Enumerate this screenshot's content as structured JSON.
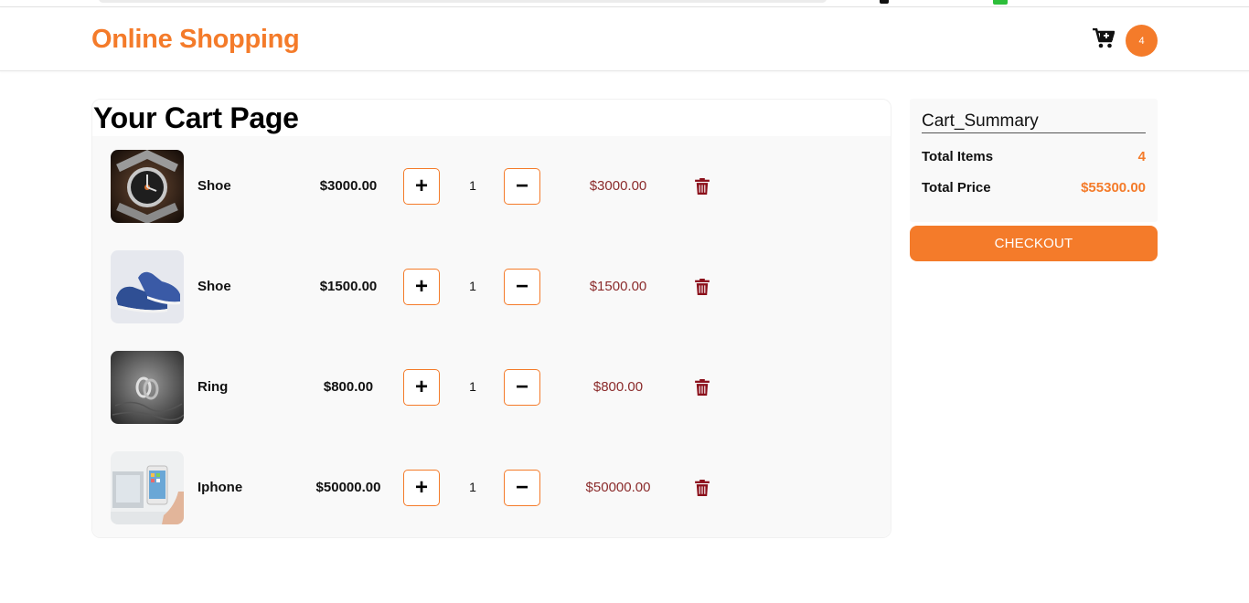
{
  "colors": {
    "accent": "#f47b2a",
    "subtotal": "#8b2b2b",
    "delete": "#8b0f1a"
  },
  "header": {
    "brand": "Online Shopping",
    "cart_icon": "shopping-cart-icon",
    "cart_count": "4"
  },
  "cart": {
    "title": "Your Cart Page",
    "items": [
      {
        "name": "Shoe",
        "price": "$3000.00",
        "quantity": "1",
        "subtotal": "$3000.00",
        "image": "watch"
      },
      {
        "name": "Shoe",
        "price": "$1500.00",
        "quantity": "1",
        "subtotal": "$1500.00",
        "image": "blue-shoe"
      },
      {
        "name": "Ring",
        "price": "$800.00",
        "quantity": "1",
        "subtotal": "$800.00",
        "image": "ring"
      },
      {
        "name": "Iphone",
        "price": "$50000.00",
        "quantity": "1",
        "subtotal": "$50000.00",
        "image": "iphone"
      }
    ],
    "plus_label": "+",
    "minus_label": "−",
    "delete_icon": "trash-icon"
  },
  "summary": {
    "title": "Cart_Summary",
    "total_items_label": "Total Items",
    "total_items_value": "4",
    "total_price_label": "Total Price",
    "total_price_value": "$55300.00",
    "checkout_label": "CHECKOUT"
  }
}
